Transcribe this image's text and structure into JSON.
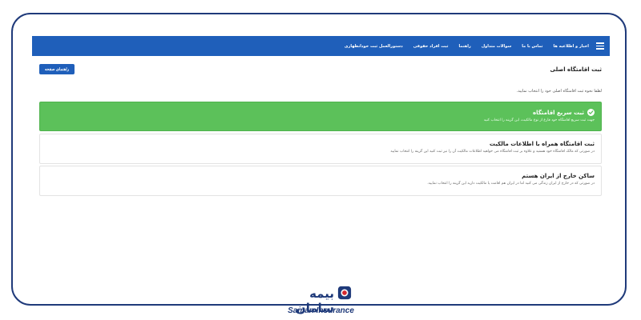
{
  "nav": {
    "items": [
      "اخبار و اطلاعیه ها",
      "تماس با ما",
      "سوالات متداول",
      "راهنما",
      "ثبت افراد حقوقی",
      "دستورالعمل ثبت خودانظهاری"
    ],
    "menu_icon": "hamburger-icon"
  },
  "header": {
    "help_button": "راهنمای صفحه",
    "title": "ثبت اقامتگاه اصلی"
  },
  "instruction": "لطفا نحوه ثبت اقامتگاه اصلی خود را انتخاب نمایید.",
  "options": [
    {
      "title": "ثبت سریع اقامتگاه",
      "desc": "جهت ثبت سریع اقامتگاه خود فارغ از نوع مالکیت، این گزینه را انتخاب کنید",
      "selected": true
    },
    {
      "title": "ثبت اقامتگاه همراه با اطلاعات مالکیت",
      "desc": "در صورتی که مالک اقامتگاه خود هستید و علاوه بر ثبت اقامتگاه می خواهید اطلاعات مالکیت آن را نیز ثبت کنید این گزینه را انتخاب نمایید",
      "selected": false
    },
    {
      "title": "ساکن خارج از ایران هستم",
      "desc": "در صورتی که در خارج از ایران زندگی می کنید اما در ایران هم اقامت یا مالکیت دارید این گزینه را انتخاب نمایید.",
      "selected": false
    }
  ],
  "logo": {
    "script": "بیمه سامان",
    "english": "Saman Insurance"
  },
  "colors": {
    "navbar": "#1f5fba",
    "selected_option": "#5cc15a",
    "frame": "#1f3a7a",
    "logo_red": "#d6282e"
  }
}
